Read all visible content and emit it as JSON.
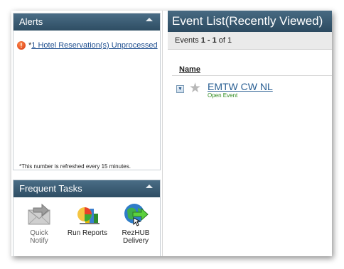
{
  "alerts": {
    "title": "Alerts",
    "icon": "alert-icon",
    "item_prefix": "*",
    "item_link": "1 Hotel Reservation(s) Unprocessed",
    "note": "*This number is refreshed every 15 minutes."
  },
  "tasks": {
    "title": "Frequent Tasks",
    "items": [
      {
        "label_line1": "Quick",
        "label_line2": "Notify",
        "icon": "envelope-icon"
      },
      {
        "label_line1": "Run Reports",
        "label_line2": "",
        "icon": "report-chart-icon"
      },
      {
        "label_line1": "RezHUB",
        "label_line2": "Delivery",
        "icon": "globe-delivery-icon"
      }
    ]
  },
  "events": {
    "title": "Event List(Recently Viewed)",
    "pager_prefix": "Events ",
    "range_start": "1",
    "range_sep": " - ",
    "range_end": "1",
    "total_text": " of 1",
    "column_name": "Name",
    "rows": [
      {
        "name": "EMTW CW NL",
        "status": "Open Event"
      }
    ]
  },
  "colors": {
    "header_bg": "#355970",
    "link": "#1f4f8f",
    "status_green": "#2e8b1e"
  }
}
